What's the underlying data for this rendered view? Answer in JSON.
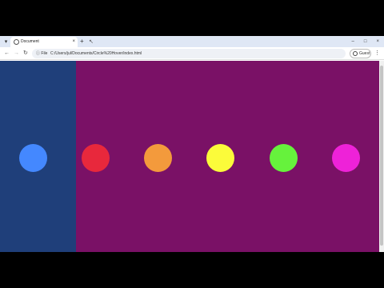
{
  "browser": {
    "tab_title": "Document",
    "tab_close": "×",
    "new_tab": "+",
    "tab_menu": "▾",
    "window_buttons": [
      "–",
      "□",
      "×"
    ],
    "nav": {
      "back": "←",
      "forward": "→",
      "reload": "↻"
    },
    "address": {
      "info_label": "ⓘ File",
      "url": "C:/Users/jul/Documents/Circle%20Hover/index.html"
    },
    "guest_label": "Guest",
    "menu": "⋮"
  },
  "page": {
    "left_panel_color": "#1f3f7a",
    "background_color": "#7a1166",
    "circles": [
      {
        "name": "blue",
        "color": "#4488ff"
      },
      {
        "name": "red",
        "color": "#e8283c"
      },
      {
        "name": "orange",
        "color": "#f39a3c"
      },
      {
        "name": "yellow",
        "color": "#fbfb3a"
      },
      {
        "name": "green",
        "color": "#66f23c"
      },
      {
        "name": "magenta",
        "color": "#ee22d8"
      }
    ]
  }
}
